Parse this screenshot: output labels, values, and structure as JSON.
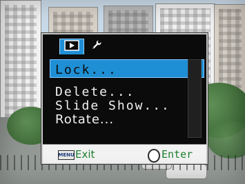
{
  "osd": {
    "tabs": [
      {
        "name": "Playback",
        "icon": "playback-tab-icon"
      },
      {
        "name": "Setup",
        "icon": "wrench-icon"
      }
    ],
    "menu": {
      "items": [
        {
          "label": "Lock...",
          "selected": true
        },
        {
          "label": "Delete...",
          "selected": false
        },
        {
          "label": "Slide Show...",
          "selected": false
        },
        {
          "label": "Rotate...",
          "selected": false
        }
      ]
    },
    "footer": {
      "menu_key": "MENU",
      "exit_label": "Exit",
      "enter_label": "Enter"
    },
    "colors": {
      "highlight": "#1f8fd5",
      "footer_text": "#1c7f2e",
      "menu_bg": "#0b0b0b"
    }
  }
}
